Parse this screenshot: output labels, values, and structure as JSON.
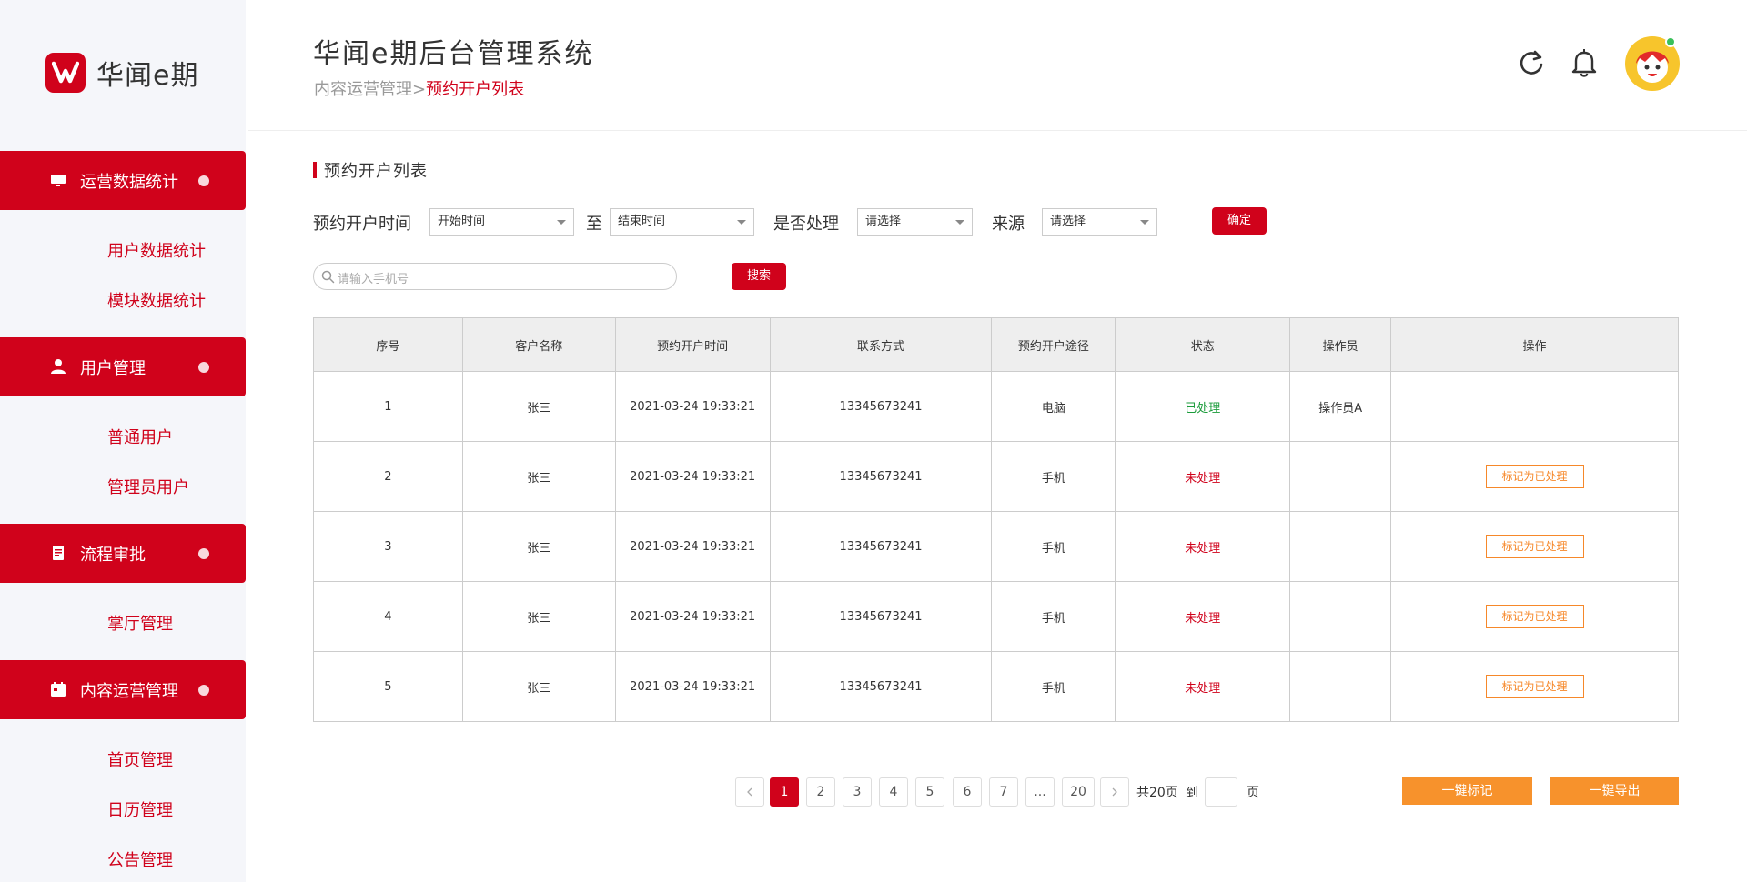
{
  "brand": {
    "name": "华闻e期"
  },
  "header": {
    "title": "华闻e期后台管理系统"
  },
  "breadcrumb": {
    "parent": "内容运营管理",
    "separator": ">",
    "current": "预约开户列表"
  },
  "sidebar": {
    "groups": [
      {
        "label": "运营数据统计",
        "icon": "monitor-icon",
        "items": [
          "用户数据统计",
          "模块数据统计"
        ]
      },
      {
        "label": "用户管理",
        "icon": "user-icon",
        "items": [
          "普通用户",
          "管理员用户"
        ]
      },
      {
        "label": "流程审批",
        "icon": "document-icon",
        "items": [
          "掌厅管理"
        ]
      },
      {
        "label": "内容运营管理",
        "icon": "calendar-icon",
        "items": [
          "首页管理",
          "日历管理",
          "公告管理"
        ]
      }
    ]
  },
  "section": {
    "title": "预约开户列表"
  },
  "filters": {
    "time_label": "预约开户时间",
    "start_placeholder": "开始时间",
    "to_label": "至",
    "end_placeholder": "结束时间",
    "processed_label": "是否处理",
    "processed_placeholder": "请选择",
    "source_label": "来源",
    "source_placeholder": "请选择",
    "confirm_label": "确定"
  },
  "search": {
    "placeholder": "请输入手机号",
    "button_label": "搜索"
  },
  "table": {
    "headers": [
      "序号",
      "客户名称",
      "预约开户时间",
      "联系方式",
      "预约开户途径",
      "状态",
      "操作员",
      "操作"
    ],
    "rows": [
      {
        "no": "1",
        "name": "张三",
        "time": "2021-03-24 19:33:21",
        "phone": "13345673241",
        "channel": "电脑",
        "status": "已处理",
        "operator": "操作员A",
        "action": ""
      },
      {
        "no": "2",
        "name": "张三",
        "time": "2021-03-24 19:33:21",
        "phone": "13345673241",
        "channel": "手机",
        "status": "未处理",
        "operator": "",
        "action": "标记为已处理"
      },
      {
        "no": "3",
        "name": "张三",
        "time": "2021-03-24 19:33:21",
        "phone": "13345673241",
        "channel": "手机",
        "status": "未处理",
        "operator": "",
        "action": "标记为已处理"
      },
      {
        "no": "4",
        "name": "张三",
        "time": "2021-03-24 19:33:21",
        "phone": "13345673241",
        "channel": "手机",
        "status": "未处理",
        "operator": "",
        "action": "标记为已处理"
      },
      {
        "no": "5",
        "name": "张三",
        "time": "2021-03-24 19:33:21",
        "phone": "13345673241",
        "channel": "手机",
        "status": "未处理",
        "operator": "",
        "action": "标记为已处理"
      }
    ]
  },
  "pagination": {
    "prev": "<",
    "pages": [
      "1",
      "2",
      "3",
      "4",
      "5",
      "6",
      "7",
      "...",
      "20"
    ],
    "next": ">",
    "current": "1",
    "total_text": "共20页",
    "goto_label": "到",
    "page_suffix": "页"
  },
  "actions": {
    "mark_all_label": "一键标记",
    "export_label": "一键导出"
  },
  "colors": {
    "brand_red": "#d0021b",
    "accent_orange": "#f7922c",
    "done_green": "#1a9b3a"
  }
}
